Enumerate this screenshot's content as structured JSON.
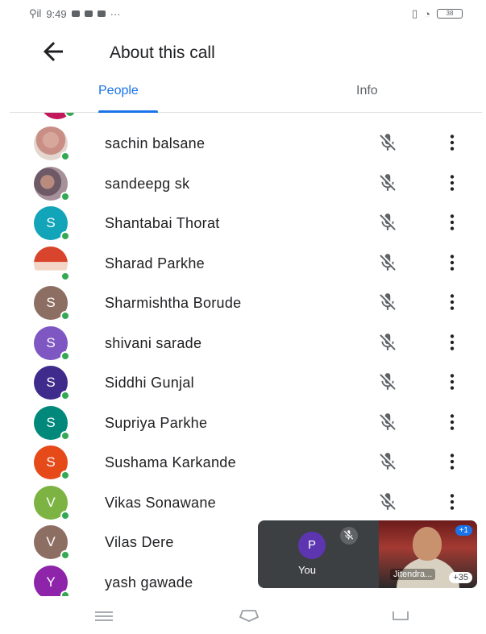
{
  "status_bar": {
    "time": "9:49",
    "signal_text": "⚲il",
    "icons": [
      "notification-icon",
      "notification-icon",
      "notification-icon"
    ],
    "ellipsis": "···",
    "battery": "38"
  },
  "app_bar": {
    "back_icon": "arrow-left-icon",
    "title": "About this call"
  },
  "tabs": [
    {
      "label": "People",
      "selected": true
    },
    {
      "label": "Info",
      "selected": false
    }
  ],
  "participants": [
    {
      "name": "sachin balsane",
      "avatar_type": "photo",
      "avatar_letter": "",
      "color": "#c98f86"
    },
    {
      "name": "sandeepg sk",
      "avatar_type": "photo",
      "avatar_letter": "",
      "color": "#6e5a66"
    },
    {
      "name": "Shantabai Thorat",
      "avatar_type": "letter",
      "avatar_letter": "S",
      "color": "#12a4b8"
    },
    {
      "name": "Sharad Parkhe",
      "avatar_type": "photo",
      "avatar_letter": "",
      "color": "#d9442c"
    },
    {
      "name": "Sharmishtha Borude",
      "avatar_type": "letter",
      "avatar_letter": "S",
      "color": "#8d6e63"
    },
    {
      "name": "shivani sarade",
      "avatar_type": "letter",
      "avatar_letter": "S",
      "color": "#7e57c2"
    },
    {
      "name": "Siddhi Gunjal",
      "avatar_type": "letter",
      "avatar_letter": "S",
      "color": "#3f2b8c"
    },
    {
      "name": "Supriya Parkhe",
      "avatar_type": "letter",
      "avatar_letter": "S",
      "color": "#00897b"
    },
    {
      "name": "Sushama Karkande",
      "avatar_type": "letter",
      "avatar_letter": "S",
      "color": "#e64a19"
    },
    {
      "name": "Vikas Sonawane",
      "avatar_type": "letter",
      "avatar_letter": "V",
      "color": "#7cb342"
    },
    {
      "name": "Vilas Dere",
      "avatar_type": "letter",
      "avatar_letter": "V",
      "color": "#8d6e63"
    },
    {
      "name": "yash gawade",
      "avatar_type": "letter",
      "avatar_letter": "Y",
      "color": "#8e24aa"
    }
  ],
  "row_icons": {
    "mic": "mic-off-icon",
    "more": "more-vert-icon"
  },
  "self_preview": {
    "avatar_letter": "P",
    "label": "You",
    "avatar_color": "#5e35b1"
  },
  "video_tile": {
    "name": "Jitendra...",
    "badge": "+1",
    "count": "+35"
  },
  "nav_bar": {
    "menu_icon": "menu-icon",
    "home_icon": "home-icon",
    "back_icon": "back-icon"
  }
}
